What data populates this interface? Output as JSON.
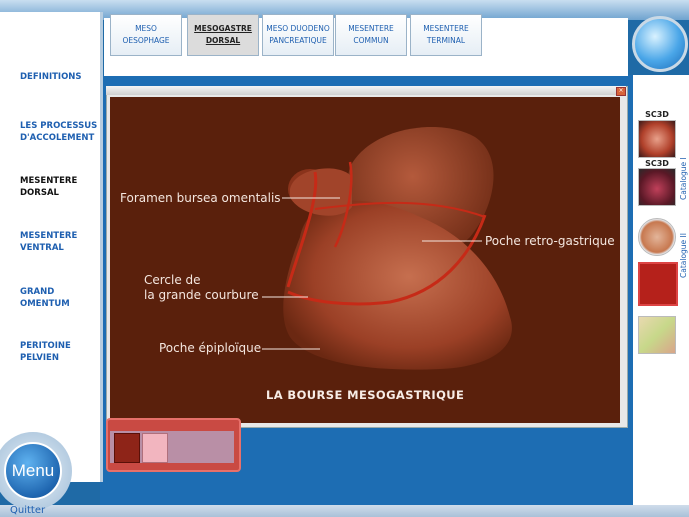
{
  "sidebar": {
    "items": [
      {
        "label": "DEFINITIONS"
      },
      {
        "label": "LES PROCESSUS D'ACCOLEMENT"
      },
      {
        "label": "MESENTERE DORSAL"
      },
      {
        "label": "MESENTERE VENTRAL"
      },
      {
        "label": "GRAND OMENTUM"
      },
      {
        "label": "PERITOINE PELVIEN"
      }
    ]
  },
  "tabs": [
    {
      "line1": "MESO",
      "line2": "OESOPHAGE"
    },
    {
      "line1": "MESOGASTRE",
      "line2": "DORSAL"
    },
    {
      "line1": "MESO DUODENO",
      "line2": "PANCREATIQUE"
    },
    {
      "line1": "MESENTERE",
      "line2": "COMMUN"
    },
    {
      "line1": "MESENTERE",
      "line2": "TERMINAL"
    }
  ],
  "viewer": {
    "labels": {
      "foramen": "Foramen bursea omentalis",
      "poche_retro": "Poche retro-gastrique",
      "cercle_1": "Cercle de",
      "cercle_2": "la grande courbure",
      "poche_epi": "Poche épiploïque"
    },
    "caption": "LA BOURSE MESOGASTRIQUE"
  },
  "right": {
    "sc3d_1": "SC3D",
    "sc3d_2": "SC3D",
    "catalogue_1": "Catalogue I",
    "catalogue_2": "Catalogue II"
  },
  "menu": {
    "label": "Menu"
  },
  "quit": {
    "label": "Quitter"
  },
  "colors": {
    "accent_blue": "#1e5fb0",
    "viewer_bg": "#5a200c",
    "annotation": "#f4e6df"
  }
}
